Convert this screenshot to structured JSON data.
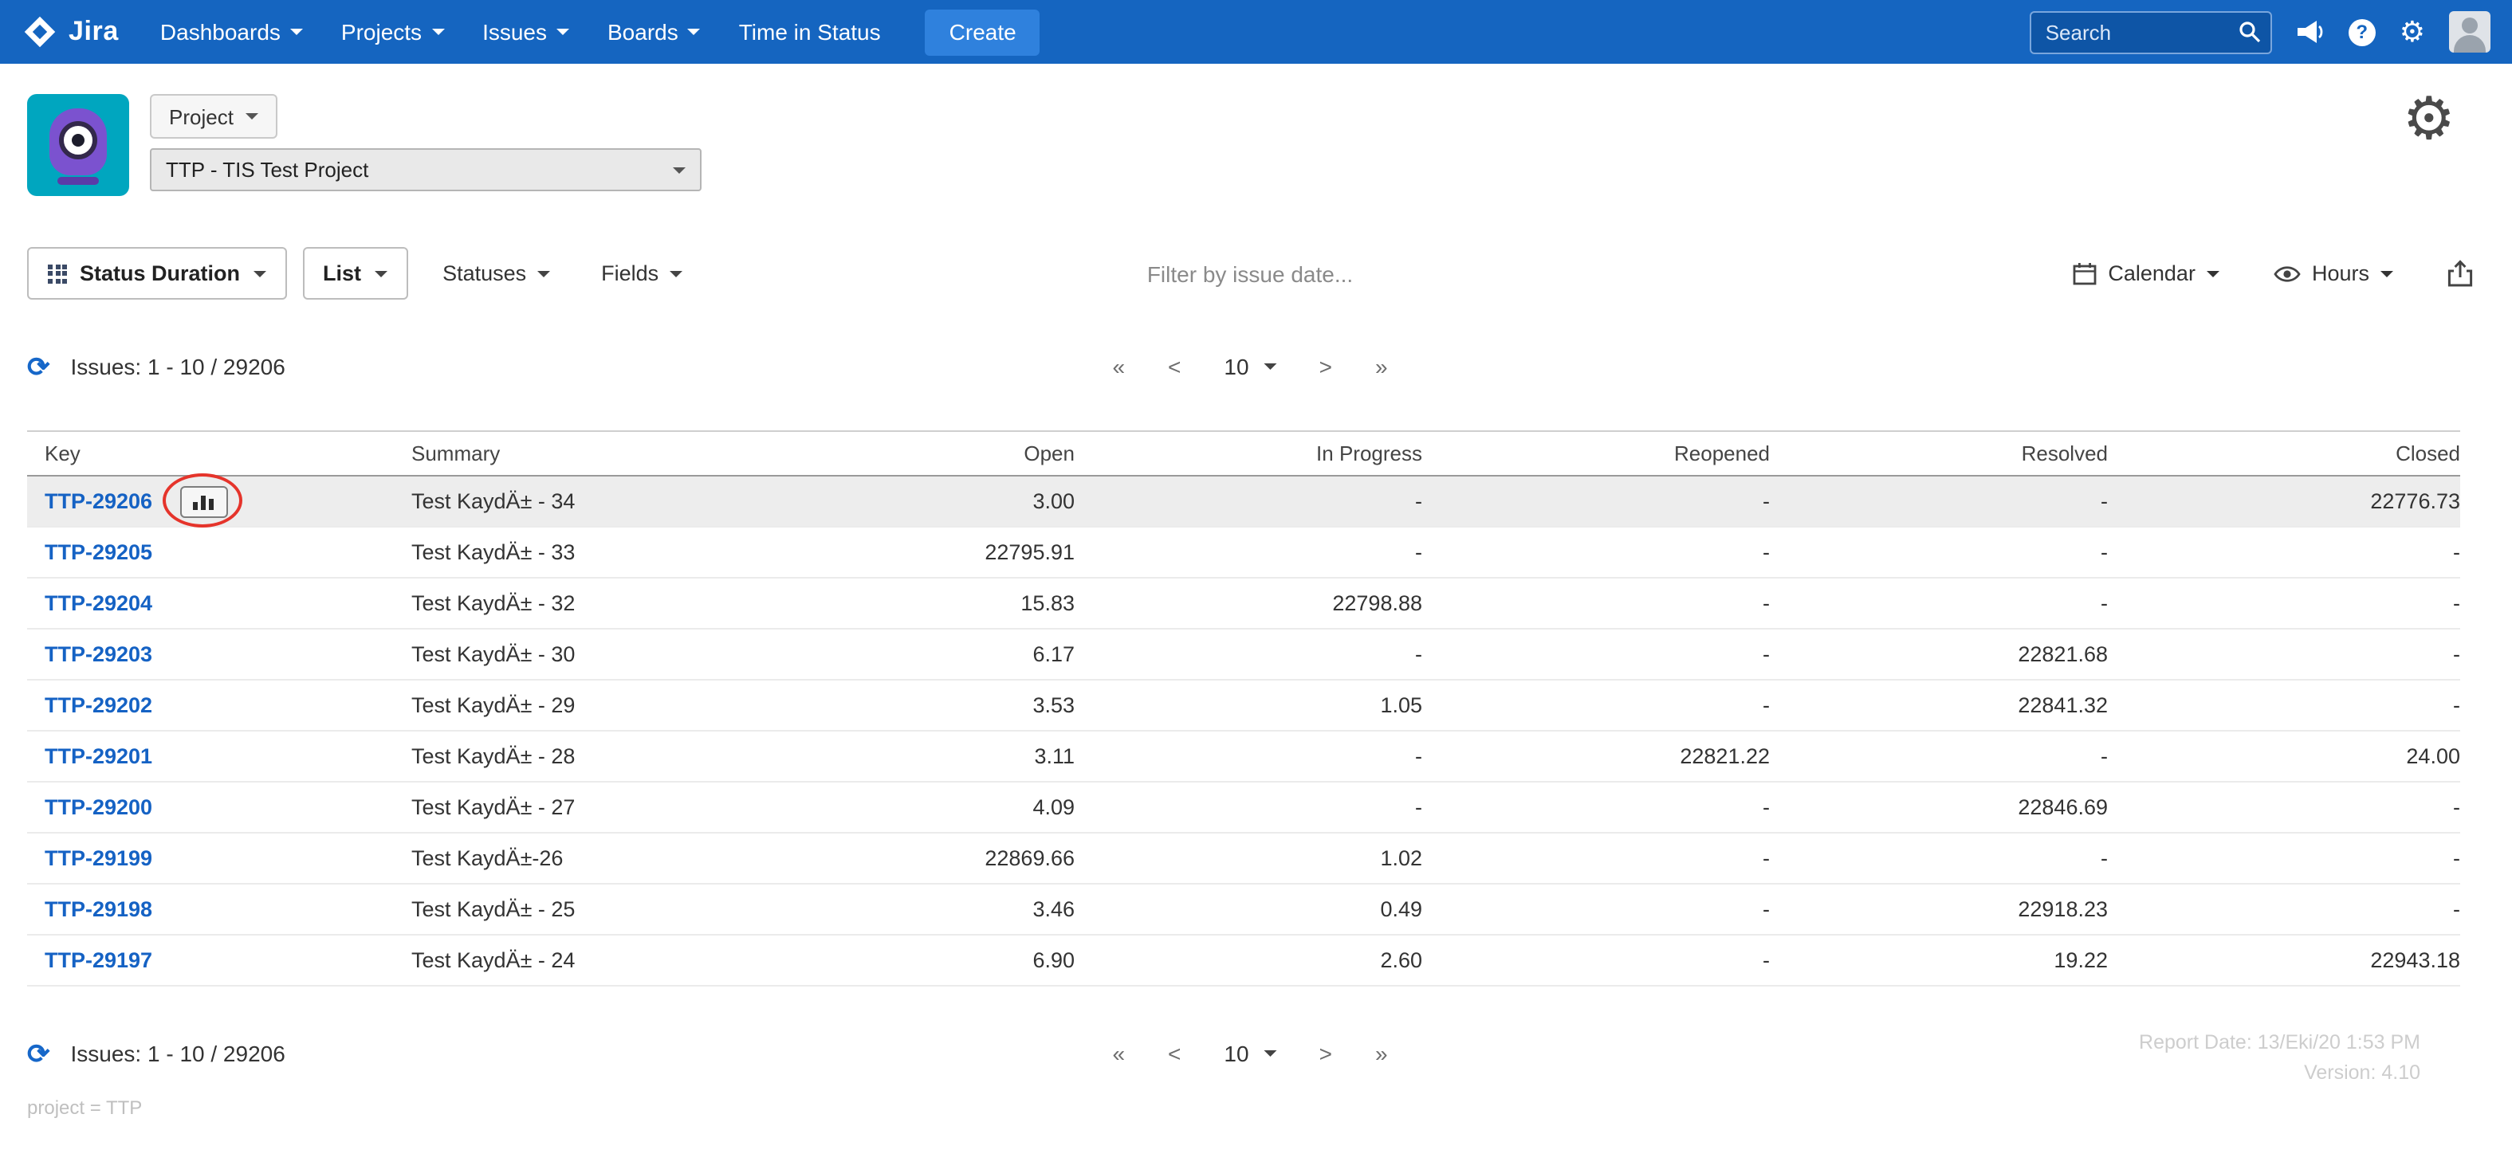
{
  "nav": {
    "brand": "Jira",
    "items": [
      {
        "label": "Dashboards"
      },
      {
        "label": "Projects"
      },
      {
        "label": "Issues"
      },
      {
        "label": "Boards"
      },
      {
        "label": "Time in Status"
      }
    ],
    "create_label": "Create",
    "search_placeholder": "Search"
  },
  "header": {
    "project_button_label": "Project",
    "project_select_value": "TTP - TIS Test Project"
  },
  "toolbar": {
    "status_duration_label": "Status Duration",
    "list_label": "List",
    "statuses_label": "Statuses",
    "fields_label": "Fields",
    "filter_placeholder": "Filter by issue date...",
    "calendar_label": "Calendar",
    "hours_label": "Hours"
  },
  "issues_bar": {
    "count_text": "Issues: 1 - 10 / 29206"
  },
  "pagination": {
    "first": "«",
    "prev": "<",
    "page_size": "10",
    "next": ">",
    "last": "»"
  },
  "table": {
    "columns": [
      "Key",
      "Summary",
      "Open",
      "In Progress",
      "Reopened",
      "Resolved",
      "Closed"
    ],
    "rows": [
      {
        "key": "TTP-29206",
        "summary": "Test KaydÄ± - 34",
        "open": "3.00",
        "in_progress": "-",
        "reopened": "-",
        "resolved": "-",
        "closed": "22776.73",
        "highlighted": true,
        "chart_icon": true
      },
      {
        "key": "TTP-29205",
        "summary": "Test KaydÄ± - 33",
        "open": "22795.91",
        "in_progress": "-",
        "reopened": "-",
        "resolved": "-",
        "closed": "-"
      },
      {
        "key": "TTP-29204",
        "summary": "Test KaydÄ± - 32",
        "open": "15.83",
        "in_progress": "22798.88",
        "reopened": "-",
        "resolved": "-",
        "closed": "-"
      },
      {
        "key": "TTP-29203",
        "summary": "Test KaydÄ± - 30",
        "open": "6.17",
        "in_progress": "-",
        "reopened": "-",
        "resolved": "22821.68",
        "closed": "-"
      },
      {
        "key": "TTP-29202",
        "summary": "Test KaydÄ± - 29",
        "open": "3.53",
        "in_progress": "1.05",
        "reopened": "-",
        "resolved": "22841.32",
        "closed": "-"
      },
      {
        "key": "TTP-29201",
        "summary": "Test KaydÄ± - 28",
        "open": "3.11",
        "in_progress": "-",
        "reopened": "22821.22",
        "resolved": "-",
        "closed": "24.00"
      },
      {
        "key": "TTP-29200",
        "summary": "Test KaydÄ± - 27",
        "open": "4.09",
        "in_progress": "-",
        "reopened": "-",
        "resolved": "22846.69",
        "closed": "-"
      },
      {
        "key": "TTP-29199",
        "summary": "Test KaydÄ±-26",
        "open": "22869.66",
        "in_progress": "1.02",
        "reopened": "-",
        "resolved": "-",
        "closed": "-"
      },
      {
        "key": "TTP-29198",
        "summary": "Test KaydÄ± - 25",
        "open": "3.46",
        "in_progress": "0.49",
        "reopened": "-",
        "resolved": "22918.23",
        "closed": "-"
      },
      {
        "key": "TTP-29197",
        "summary": "Test KaydÄ± - 24",
        "open": "6.90",
        "in_progress": "2.60",
        "reopened": "-",
        "resolved": "19.22",
        "closed": "22943.18"
      }
    ]
  },
  "footer": {
    "count_text": "Issues: 1 - 10 / 29206",
    "report_date": "Report Date: 13/Eki/20 1:53 PM",
    "version": "Version: 4.10",
    "query": "project = TTP"
  },
  "icons": {
    "gear": "⚙",
    "refresh": "⟳"
  },
  "colors": {
    "nav": "#1565c0",
    "create": "#2f81dd",
    "link": "#1562c4",
    "highlight_row": "#ededed",
    "oval_red": "#e5342b",
    "avatar_teal": "#00a6bf",
    "avatar_purple": "#7b52cf"
  }
}
